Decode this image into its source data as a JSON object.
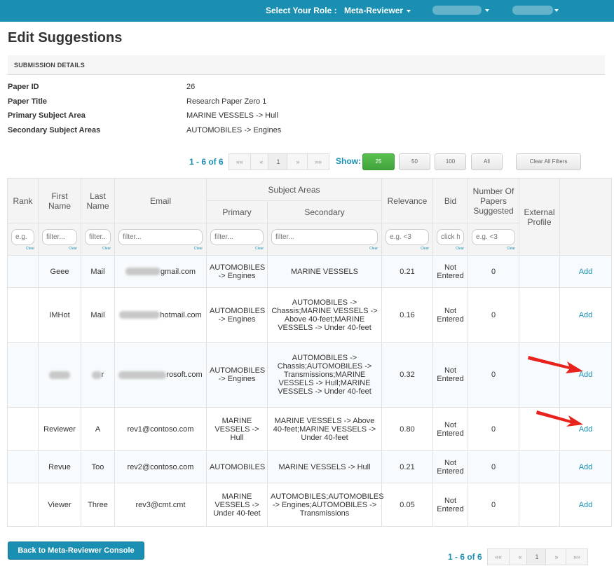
{
  "header": {
    "role_label": "Select Your Role :",
    "role_value": "Meta-Reviewer"
  },
  "page_title": "Edit Suggestions",
  "section_title": "SUBMISSION DETAILS",
  "details": [
    {
      "label": "Paper ID",
      "value": "26"
    },
    {
      "label": "Paper Title",
      "value": "Research Paper Zero 1"
    },
    {
      "label": "Primary Subject Area",
      "value": "MARINE VESSELS -> Hull"
    },
    {
      "label": "Secondary Subject Areas",
      "value": "AUTOMOBILES -> Engines"
    }
  ],
  "pager": {
    "count": "1 - 6 of 6",
    "first": "««",
    "prev": "«",
    "page": "1",
    "next": "»",
    "last": "»»"
  },
  "show": {
    "label": "Show:",
    "options": [
      "25",
      "50",
      "100",
      "All"
    ],
    "clear_all": "Clear All Filters"
  },
  "table": {
    "headers": {
      "rank": "Rank",
      "first_name": "First Name",
      "last_name": "Last Name",
      "email": "Email",
      "subject_areas": "Subject Areas",
      "primary": "Primary",
      "secondary": "Secondary",
      "relevance": "Relevance",
      "bid": "Bid",
      "papers": "Number Of Papers Suggested",
      "external": "External Profile"
    },
    "filters": {
      "rank": "e.g.",
      "first_name": "filter...",
      "last_name": "filter...",
      "email": "filter...",
      "primary": "filter...",
      "secondary": "filter...",
      "relevance": "e.g. <3",
      "bid": "click here",
      "papers": "e.g. <3",
      "clear": "Clear"
    },
    "rows": [
      {
        "first": "Geee",
        "last": "Mail",
        "email": "gmail.com",
        "primary": "AUTOMOBILES -> Engines",
        "secondary": "MARINE VESSELS",
        "relevance": "0.21",
        "bid": "Not Entered",
        "papers": "0",
        "action": "Add"
      },
      {
        "first": "IMHot",
        "last": "Mail",
        "email": "hotmail.com",
        "primary": "AUTOMOBILES -> Engines",
        "secondary": "AUTOMOBILES -> Chassis;MARINE VESSELS -> Above 40-feet;MARINE VESSELS -> Under 40-feet",
        "relevance": "0.16",
        "bid": "Not Entered",
        "papers": "0",
        "action": "Add"
      },
      {
        "first": "",
        "last": "r",
        "email": "rosoft.com",
        "primary": "AUTOMOBILES -> Engines",
        "secondary": "AUTOMOBILES -> Chassis;AUTOMOBILES -> Transmissions;MARINE VESSELS -> Hull;MARINE VESSELS -> Under 40-feet",
        "relevance": "0.32",
        "bid": "Not Entered",
        "papers": "0",
        "action": "Add"
      },
      {
        "first": "Reviewer",
        "last": "A",
        "email": "rev1@contoso.com",
        "primary": "MARINE VESSELS -> Hull",
        "secondary": "MARINE VESSELS -> Above 40-feet;MARINE VESSELS -> Under 40-feet",
        "relevance": "0.80",
        "bid": "Not Entered",
        "papers": "0",
        "action": "Add"
      },
      {
        "first": "Revue",
        "last": "Too",
        "email": "rev2@contoso.com",
        "primary": "AUTOMOBILES",
        "secondary": "MARINE VESSELS -> Hull",
        "relevance": "0.21",
        "bid": "Not Entered",
        "papers": "0",
        "action": "Add"
      },
      {
        "first": "Viewer",
        "last": "Three",
        "email": "rev3@cmt.cmt",
        "primary": "MARINE VESSELS -> Under 40-feet",
        "secondary": "AUTOMOBILES;AUTOMOBILES -> Engines;AUTOMOBILES -> Transmissions",
        "relevance": "0.05",
        "bid": "Not Entered",
        "papers": "0",
        "action": "Add"
      }
    ]
  },
  "back_button": "Back to Meta-Reviewer Console",
  "colors": {
    "primary": "#1b8fb1",
    "active_show": "#4cb545",
    "arrow": "#e8231d"
  }
}
